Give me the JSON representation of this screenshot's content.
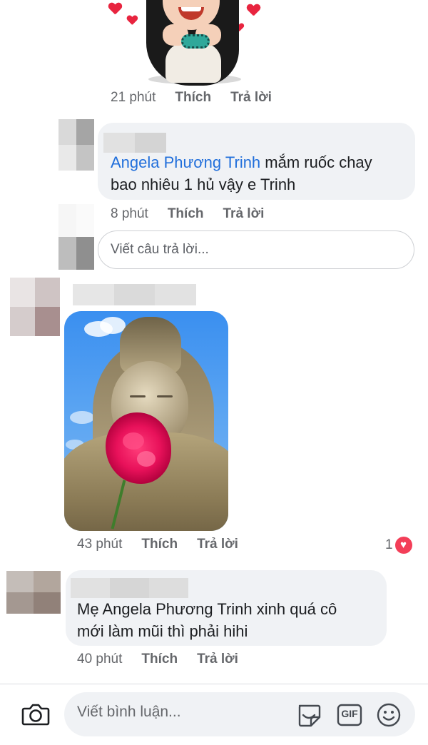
{
  "colors": {
    "bubble_bg": "#f0f2f5",
    "mention": "#216fdb",
    "meta_text": "#65676b",
    "like_heart": "#f33e58"
  },
  "comments": [
    {
      "time": "21 phút",
      "like_label": "Thích",
      "reply_label": "Trả lời",
      "attachment": "sticker"
    },
    {
      "mention": "Angela Phương Trinh",
      "text_line1_rest": " mắm ruốc chay",
      "text_line2": "bao nhiêu 1 hủ vậy e Trinh",
      "time": "8 phút",
      "like_label": "Thích",
      "reply_label": "Trả lời"
    },
    {
      "attachment": "photo",
      "time": "43 phút",
      "like_label": "Thích",
      "reply_label": "Trả lời",
      "reaction_count": "1",
      "reaction_icon": "heart-icon"
    },
    {
      "text_line1": "Mẹ Angela Phương Trinh xinh quá  cô",
      "text_line2": "mới làm mũi thì phải hihi",
      "time": "40 phút",
      "like_label": "Thích",
      "reply_label": "Trả lời"
    }
  ],
  "reply_input": {
    "placeholder": "Viết câu trả lời..."
  },
  "bottom_bar": {
    "placeholder": "Viết bình luận...",
    "camera_icon": "camera-icon",
    "sticker_icon": "sticker-icon",
    "gif_label": "GIF",
    "emoji_icon": "emoji-icon"
  }
}
